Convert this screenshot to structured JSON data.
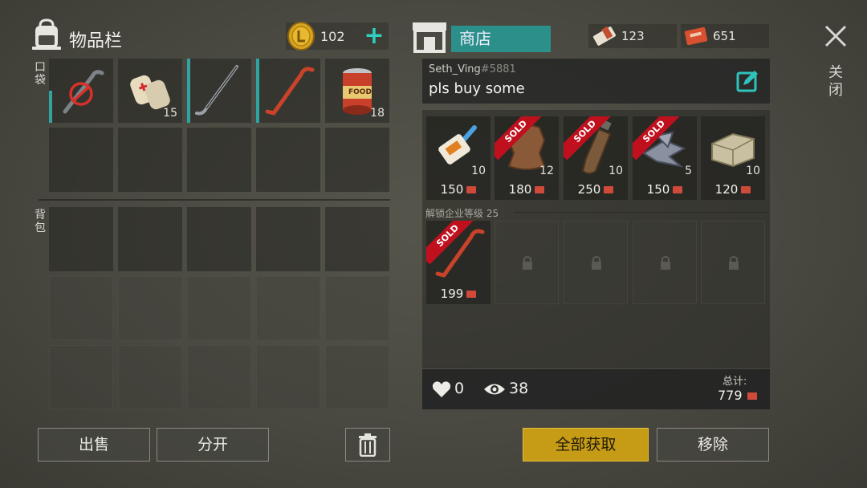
{
  "inventory": {
    "title": "物品栏",
    "coins": "102",
    "plus": "+",
    "pocket_label": "口袋",
    "backpack_label": "背包",
    "pocket_slots": [
      {
        "item": "crowbar-broken",
        "qty": ""
      },
      {
        "item": "bandage",
        "qty": "15"
      },
      {
        "item": "hockey-stick",
        "qty": ""
      },
      {
        "item": "crowbar",
        "qty": ""
      },
      {
        "item": "canned-food",
        "qty": "18",
        "can_label": "FOOD"
      }
    ]
  },
  "shop": {
    "tab_label": "商店",
    "resource_1": "123",
    "resource_2": "651",
    "seller": "Seth_Ving",
    "seller_tag": "#5881",
    "message": "pls buy some",
    "items": [
      {
        "item": "glue",
        "qty": "10",
        "price": "150",
        "sold": false
      },
      {
        "item": "leather",
        "qty": "12",
        "price": "180",
        "sold": true
      },
      {
        "item": "bottle",
        "qty": "10",
        "price": "250",
        "sold": true
      },
      {
        "item": "metal-scrap",
        "qty": "5",
        "price": "150",
        "sold": true
      },
      {
        "item": "stone",
        "qty": "10",
        "price": "120",
        "sold": false
      }
    ],
    "sold_label": "SOLD",
    "unlock_note": "解锁企业等级 25",
    "row2_item": {
      "item": "crowbar",
      "price": "199",
      "sold": true
    },
    "likes": "0",
    "views": "38",
    "total_label": "总计:",
    "total_value": "779"
  },
  "buttons": {
    "sell": "出售",
    "split": "分开",
    "take_all": "全部获取",
    "remove": "移除"
  },
  "close_label": "关闭",
  "colors": {
    "accent": "#2b8f8a",
    "gold": "#c69c16",
    "sold": "#c0101e"
  }
}
